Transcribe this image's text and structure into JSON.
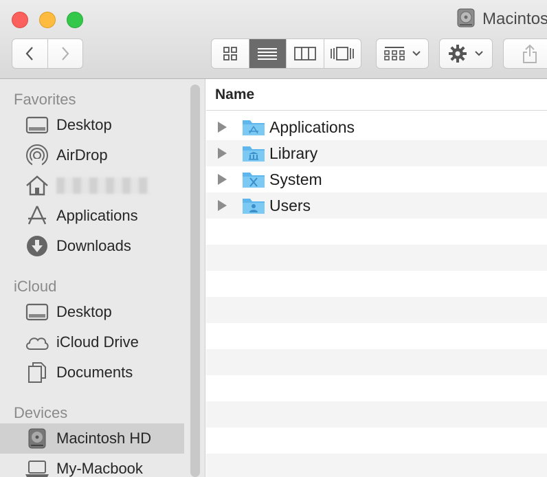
{
  "window": {
    "title": "Macintosh HD",
    "title_icon": "hard-drive-icon"
  },
  "toolbar": {
    "back_icon": "chevron-left-icon",
    "forward_icon": "chevron-right-icon",
    "view_modes": [
      "icon-view-icon",
      "list-view-icon",
      "column-view-icon",
      "cover-flow-icon"
    ],
    "active_view": "list",
    "arrange_icon": "arrange-grid-icon",
    "action_icon": "gear-icon",
    "share_icon": "share-icon"
  },
  "sidebar": {
    "sections": [
      {
        "heading": "Favorites",
        "items": [
          {
            "label": "Desktop",
            "icon": "desktop-icon"
          },
          {
            "label": "AirDrop",
            "icon": "airdrop-icon"
          },
          {
            "label": "",
            "icon": "home-icon"
          },
          {
            "label": "Applications",
            "icon": "applications-icon"
          },
          {
            "label": "Downloads",
            "icon": "downloads-icon"
          }
        ]
      },
      {
        "heading": "iCloud",
        "items": [
          {
            "label": "Desktop",
            "icon": "desktop-icon"
          },
          {
            "label": "iCloud Drive",
            "icon": "cloud-icon"
          },
          {
            "label": "Documents",
            "icon": "documents-icon"
          }
        ]
      },
      {
        "heading": "Devices",
        "items": [
          {
            "label": "Macintosh HD",
            "icon": "hard-drive-icon",
            "selected": true
          },
          {
            "label": "My-Macbook",
            "icon": "laptop-icon"
          }
        ]
      }
    ]
  },
  "main": {
    "column_header": "Name",
    "rows": [
      {
        "name": "Applications",
        "icon": "applications-folder-icon"
      },
      {
        "name": "Library",
        "icon": "library-folder-icon"
      },
      {
        "name": "System",
        "icon": "system-folder-icon"
      },
      {
        "name": "Users",
        "icon": "users-folder-icon"
      }
    ]
  },
  "colors": {
    "folder": "#6cc0f0",
    "selected_item": "#d0d0d0",
    "close": "#fc605c",
    "minimize": "#fdbc40",
    "maximize": "#34c84a"
  }
}
